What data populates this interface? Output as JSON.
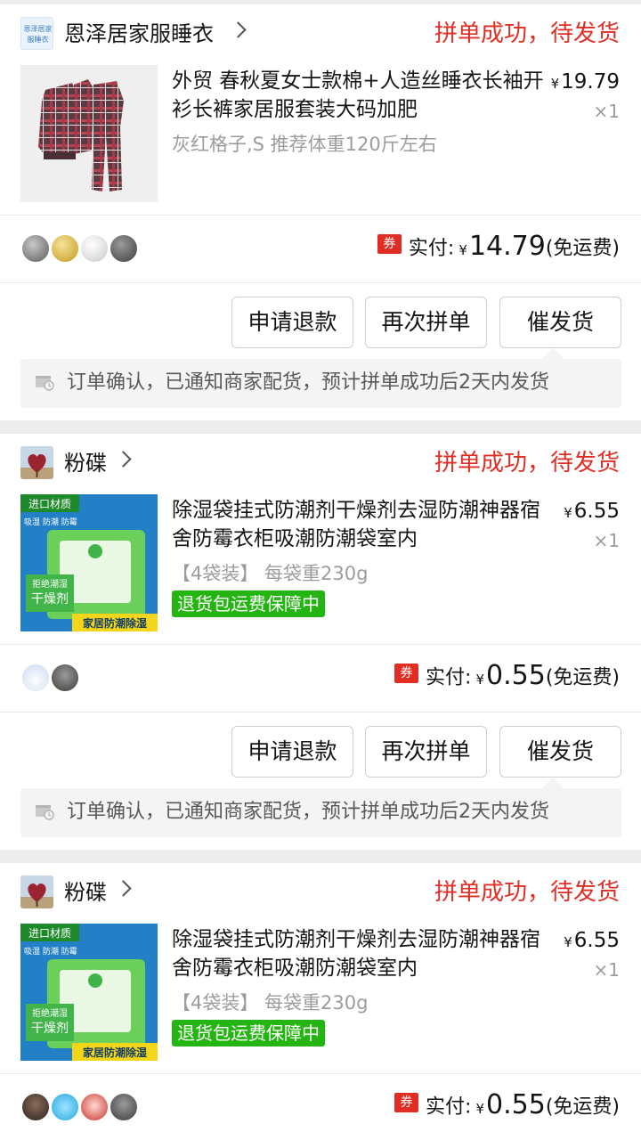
{
  "orders": [
    {
      "shop": {
        "name": "恩泽居家服睡衣",
        "logo_text": "恩泽居家 服睡衣"
      },
      "status": "拼单成功，待发货",
      "product": {
        "title": "外贸 春秋夏女士款棉+人造丝睡衣长袖开衫长裤家居服套装大码加肥",
        "spec": "灰红格子,S 推荐体重120斤左右",
        "price": "19.79",
        "currency": "¥",
        "qty": "×1",
        "image": "plaid-pajamas"
      },
      "group_avatars": [
        "avatar-grey",
        "avatar-gold",
        "avatar-silver",
        "avatar-dark"
      ],
      "coupon": "券",
      "pay_label": "实付:",
      "pay_amount": "14.79",
      "pay_note": "(免运费)",
      "buttons": {
        "refund": "申请退款",
        "reorder": "再次拼单",
        "urge": "催发货"
      },
      "notice": "订单确认，已通知商家配货，预计拼单成功后2天内发货"
    },
    {
      "shop": {
        "name": "粉碟",
        "logo_text": ""
      },
      "status": "拼单成功，待发货",
      "product": {
        "title": "除湿袋挂式防潮剂干燥剂去湿防潮神器宿舍防霉衣柜吸潮防潮袋室内",
        "spec": "【4袋装】 每袋重230g",
        "price": "6.55",
        "currency": "¥",
        "qty": "×1",
        "guarantee": "退货包运费保障中",
        "image": "dehumidifier-bag",
        "image_texts": {
          "tag": "进口材质",
          "sub": "吸湿 防潮 防霉",
          "bag": "干燥剂",
          "bag_sub": "拒绝潮湿",
          "banner": "家居防潮除湿"
        }
      },
      "group_avatars": [
        "avatar-cartoon",
        "avatar-person"
      ],
      "coupon": "券",
      "pay_label": "实付:",
      "pay_amount": "0.55",
      "pay_note": "(免运费)",
      "buttons": {
        "refund": "申请退款",
        "reorder": "再次拼单",
        "urge": "催发货"
      },
      "notice": "订单确认，已通知商家配货，预计拼单成功后2天内发货"
    },
    {
      "shop": {
        "name": "粉碟",
        "logo_text": ""
      },
      "status": "拼单成功，待发货",
      "product": {
        "title": "除湿袋挂式防潮剂干燥剂去湿防潮神器宿舍防霉衣柜吸潮防潮袋室内",
        "spec": "【4袋装】 每袋重230g",
        "price": "6.55",
        "currency": "¥",
        "qty": "×1",
        "guarantee": "退货包运费保障中",
        "image": "dehumidifier-bag",
        "image_texts": {
          "tag": "进口材质",
          "sub": "吸湿 防潮 防霉",
          "bag": "干燥剂",
          "bag_sub": "拒绝潮湿",
          "banner": "家居防潮除湿"
        }
      },
      "group_avatars": [
        "avatar-man",
        "avatar-fish",
        "avatar-girl",
        "avatar-person"
      ],
      "coupon": "券",
      "pay_label": "实付:",
      "pay_amount": "0.55",
      "pay_note": "(免运费)"
    }
  ]
}
